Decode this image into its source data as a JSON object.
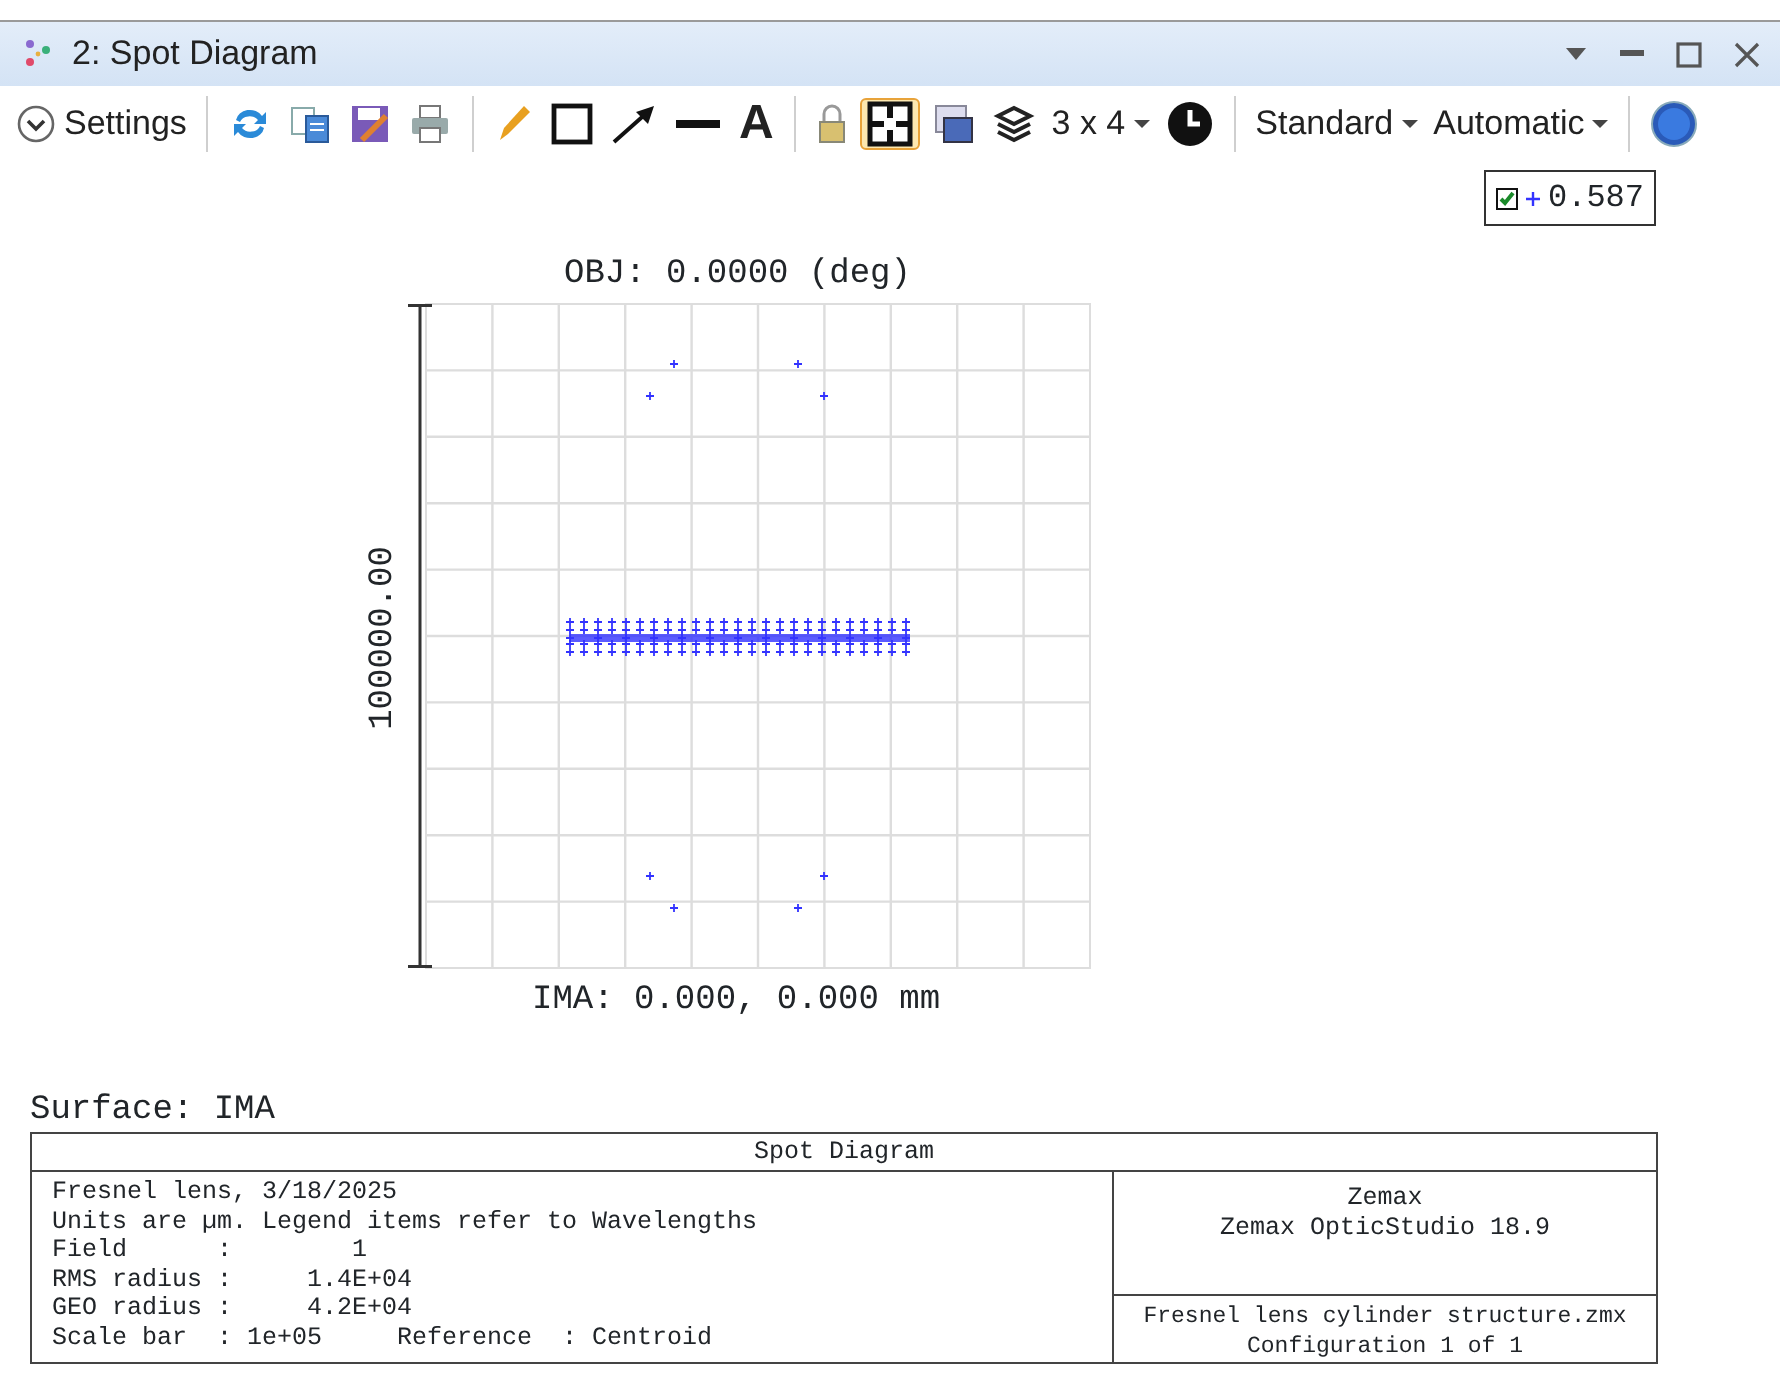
{
  "window": {
    "title": "2: Spot Diagram"
  },
  "toolbar": {
    "settings_label": "Settings",
    "text_tool": "A",
    "layout_tool": {
      "selected": true
    },
    "layout_dropdown": "3 x 4",
    "mode_dropdowns": [
      "Standard",
      "Automatic"
    ]
  },
  "legend": [
    {
      "checked": true,
      "color": "#3333ff",
      "value": "0.587"
    }
  ],
  "plot": {
    "title": "OBJ: 0.0000 (deg)",
    "scale_label": "100000.00",
    "image_label": "IMA: 0.000, 0.000 mm"
  },
  "surface": "Surface: IMA",
  "info_table": {
    "title": "Spot Diagram",
    "left_lines": [
      "Fresnel lens, 3/18/2025",
      "Units are µm. Legend items refer to Wavelengths",
      "Field      :        1",
      "RMS radius :     1.4E+04",
      "GEO radius :     4.2E+04",
      "Scale bar  : 1e+05     Reference  : Centroid"
    ],
    "right_top": [
      "Zemax",
      "Zemax OpticStudio 18.9"
    ],
    "right_bottom": [
      "Fresnel lens cylinder structure.zmx",
      "Configuration 1 of 1"
    ]
  }
}
